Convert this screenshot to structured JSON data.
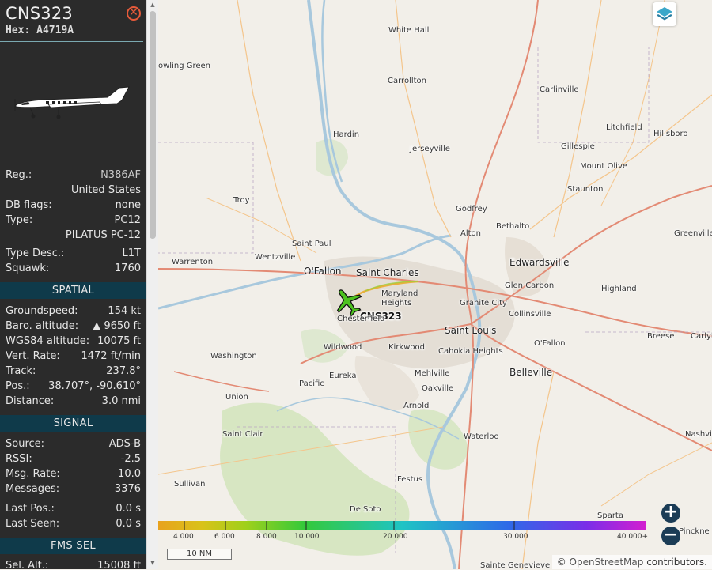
{
  "aircraft": {
    "callsign": "CNS323",
    "hex_label": "Hex:",
    "hex": "A4719A"
  },
  "details": [
    {
      "label": "Reg.:",
      "value": "N386AF"
    },
    {
      "label": "",
      "value": "United States"
    },
    {
      "label": "DB flags:",
      "value": "none"
    },
    {
      "label": "Type:",
      "value": "PC12"
    },
    {
      "label": "",
      "value": "PILATUS PC-12"
    },
    {
      "label": "Type Desc.:",
      "value": "L1T"
    },
    {
      "label": "Squawk:",
      "value": "1760"
    }
  ],
  "spatial": {
    "title": "SPATIAL",
    "rows": [
      {
        "label": "Groundspeed:",
        "value": "154 kt"
      },
      {
        "label": "Baro. altitude:",
        "value": "▲ 9650 ft"
      },
      {
        "label": "WGS84 altitude:",
        "value": "10075 ft"
      },
      {
        "label": "Vert. Rate:",
        "value": "1472 ft/min"
      },
      {
        "label": "Track:",
        "value": "237.8°"
      },
      {
        "label": "Pos.:",
        "value": "38.707°, -90.610°"
      },
      {
        "label": "Distance:",
        "value": "3.0 nmi"
      }
    ]
  },
  "signal": {
    "title": "SIGNAL",
    "rows": [
      {
        "label": "Source:",
        "value": "ADS-B"
      },
      {
        "label": "RSSI:",
        "value": "-2.5"
      },
      {
        "label": "Msg. Rate:",
        "value": "10.0"
      },
      {
        "label": "Messages:",
        "value": "3376"
      },
      {
        "label": "Last Pos.:",
        "value": "0.0 s"
      },
      {
        "label": "Last Seen:",
        "value": "0.0 s"
      }
    ]
  },
  "fms": {
    "title": "FMS SEL",
    "rows": [
      {
        "label": "Sel. Alt.:",
        "value": "15008 ft"
      }
    ]
  },
  "map": {
    "places": [
      "White Hall",
      "owling Green",
      "Carrollton",
      "Carlinville",
      "Litchfield",
      "Hillsboro",
      "Hardin",
      "Jerseyville",
      "Gillespie",
      "Mount Olive",
      "Staunton",
      "Troy",
      "Godfrey",
      "Bethalto",
      "Alton",
      "Greenville",
      "Saint Paul",
      "Wentzville",
      "Warrenton",
      "O'Fallon",
      "Saint Charles",
      "Edwardsville",
      "Glen Carbon",
      "Highland",
      "Maryland Heights",
      "Granite City",
      "Collinsville",
      "Chesterfield",
      "Saint Louis",
      "Breese",
      "Carlyl",
      "Wildwood",
      "Kirkwood",
      "Cahokia Heights",
      "O'Fallon",
      "Washington",
      "Eureka",
      "Belleville",
      "Pacific",
      "Mehlville",
      "Oakville",
      "Union",
      "Arnold",
      "Saint Clair",
      "Waterloo",
      "Nashvil",
      "Festus",
      "Sullivan",
      "De Soto",
      "Sparta",
      "Pinckney",
      "Sainte Genevieve",
      "Pinckne"
    ],
    "aircraft_label": "CNS323",
    "legend_ticks": [
      "4 000",
      "6 000",
      "8 000",
      "10 000",
      "20 000",
      "30 000",
      "40 000+"
    ],
    "scale_label": "10 NM",
    "attribution_symbol": "©",
    "attribution_link": "OpenStreetMap",
    "attribution_suffix": "contributors."
  },
  "colors": {
    "sidebar_bg": "#2b2b2b",
    "section_bg": "#0f3a4a",
    "close": "#e65a3a",
    "aircraft": "#4cc21f"
  },
  "icons": {
    "close": "close-icon",
    "layers": "layers-icon",
    "zoom_in": "plus-icon",
    "zoom_out": "minus-icon",
    "aircraft": "airplane-icon"
  }
}
